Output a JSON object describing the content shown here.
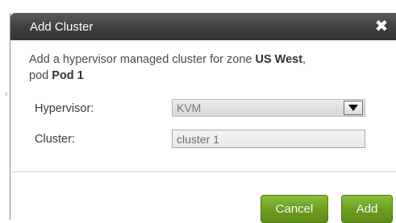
{
  "dialog": {
    "title": "Add Cluster",
    "close_icon": "close-icon",
    "description": {
      "prefix": "Add a hypervisor managed cluster for zone ",
      "zone": "US West",
      "middle": ",",
      "pod_prefix": "pod ",
      "pod": "Pod 1"
    }
  },
  "form": {
    "hypervisor": {
      "label": "Hypervisor:",
      "selected": "KVM",
      "dropdown_icon": "chevron-down-icon"
    },
    "cluster": {
      "label": "Cluster:",
      "value": "cluster 1"
    }
  },
  "actions": {
    "cancel_label": "Cancel",
    "add_label": "Add"
  },
  "colors": {
    "titlebar": "#3e3e3e",
    "button": "#6a9c1f",
    "text": "#4a4a4a"
  }
}
